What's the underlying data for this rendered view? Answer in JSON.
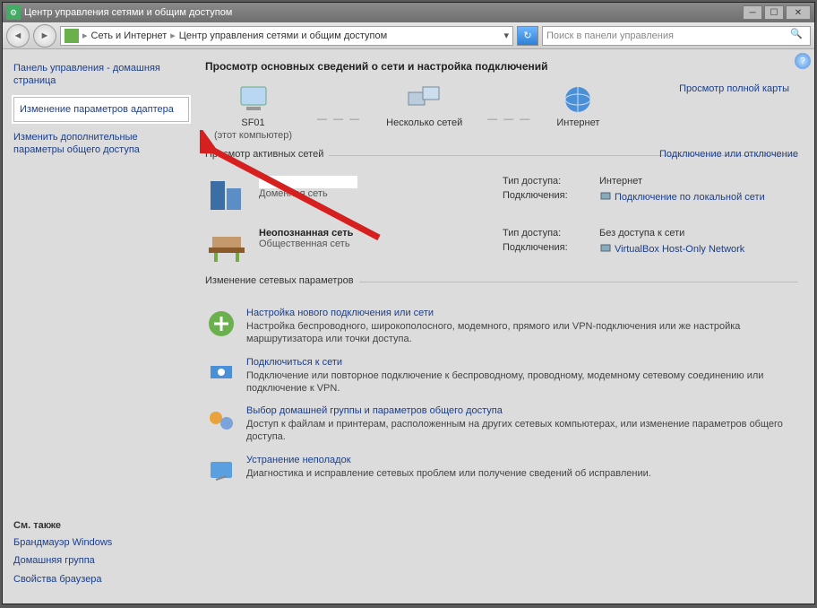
{
  "window": {
    "title": "Центр управления сетями и общим доступом"
  },
  "breadcrumb": {
    "seg1": "Сеть и Интернет",
    "seg2": "Центр управления сетями и общим доступом"
  },
  "search": {
    "placeholder": "Поиск в панели управления"
  },
  "sidebar": {
    "home": "Панель управления - домашняя страница",
    "adapter": "Изменение параметров адаптера",
    "advanced": "Изменить дополнительные параметры общего доступа",
    "seealso_hdr": "См. также",
    "seealso": [
      "Брандмауэр Windows",
      "Домашняя группа",
      "Свойства браузера"
    ]
  },
  "main": {
    "heading": "Просмотр основных сведений о сети и настройка подключений",
    "maplink": "Просмотр полной карты",
    "nodes": {
      "pc": "SF01",
      "pc_sub": "(этот компьютер)",
      "multi": "Несколько сетей",
      "internet": "Интернет"
    },
    "sec_active": "Просмотр активных сетей",
    "sec_active_link": "Подключение или отключение",
    "net1": {
      "type": "Доменная сеть",
      "k1": "Тип доступа:",
      "v1": "Интернет",
      "k2": "Подключения:",
      "v2": "Подключение по локальной сети"
    },
    "net2": {
      "name": "Неопознанная сеть",
      "type": "Общественная сеть",
      "k1": "Тип доступа:",
      "v1": "Без доступа к сети",
      "k2": "Подключения:",
      "v2": "VirtualBox Host-Only Network"
    },
    "sec_change": "Изменение сетевых параметров",
    "tasks": [
      {
        "title": "Настройка нового подключения или сети",
        "desc": "Настройка беспроводного, широкополосного, модемного, прямого или VPN-подключения или же настройка маршрутизатора или точки доступа."
      },
      {
        "title": "Подключиться к сети",
        "desc": "Подключение или повторное подключение к беспроводному, проводному, модемному сетевому соединению или подключение к VPN."
      },
      {
        "title": "Выбор домашней группы и параметров общего доступа",
        "desc": "Доступ к файлам и принтерам, расположенным на других сетевых компьютерах, или изменение параметров общего доступа."
      },
      {
        "title": "Устранение неполадок",
        "desc": "Диагностика и исправление сетевых проблем или получение сведений об исправлении."
      }
    ]
  }
}
